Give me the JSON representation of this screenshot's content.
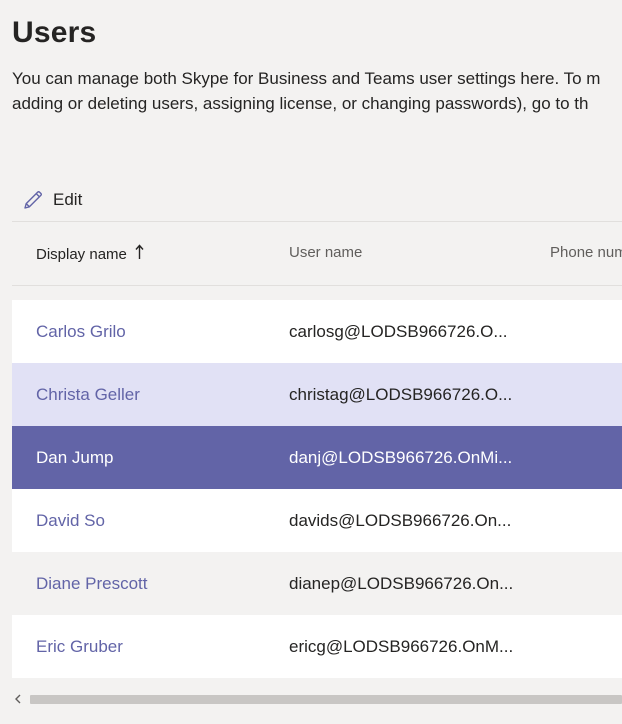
{
  "page": {
    "title": "Users",
    "description_lines": [
      "You can manage both Skype for Business and Teams user settings here. To m",
      "adding or deleting users, assigning license, or changing passwords), go to th"
    ]
  },
  "toolbar": {
    "edit_label": "Edit",
    "edit_icon": "pencil-icon"
  },
  "table": {
    "columns": {
      "display_name": "Display name",
      "user_name": "User name",
      "phone_number": "Phone num"
    },
    "sort": {
      "column": "display_name",
      "direction": "ascending",
      "icon": "arrow-up-icon"
    },
    "rows": [
      {
        "display_name": "Carlos Grilo",
        "user_name": "carlosg@LODSB966726.O...",
        "state": "normal"
      },
      {
        "display_name": "Christa Geller",
        "user_name": "christag@LODSB966726.O...",
        "state": "hover"
      },
      {
        "display_name": "Dan Jump",
        "user_name": "danj@LODSB966726.OnMi...",
        "state": "selected"
      },
      {
        "display_name": "David So",
        "user_name": "davids@LODSB966726.On...",
        "state": "normal"
      },
      {
        "display_name": "Diane Prescott",
        "user_name": "dianep@LODSB966726.On...",
        "state": "normal"
      },
      {
        "display_name": "Eric Gruber",
        "user_name": "ericg@LODSB966726.OnM...",
        "state": "normal"
      }
    ]
  },
  "scrollbar": {
    "left_arrow_icon": "chevron-left-icon"
  },
  "colors": {
    "accent": "#6264a7",
    "hover_row": "#e1e1f5",
    "background": "#f3f2f1",
    "text": "#252423",
    "muted_text": "#605e5c"
  }
}
